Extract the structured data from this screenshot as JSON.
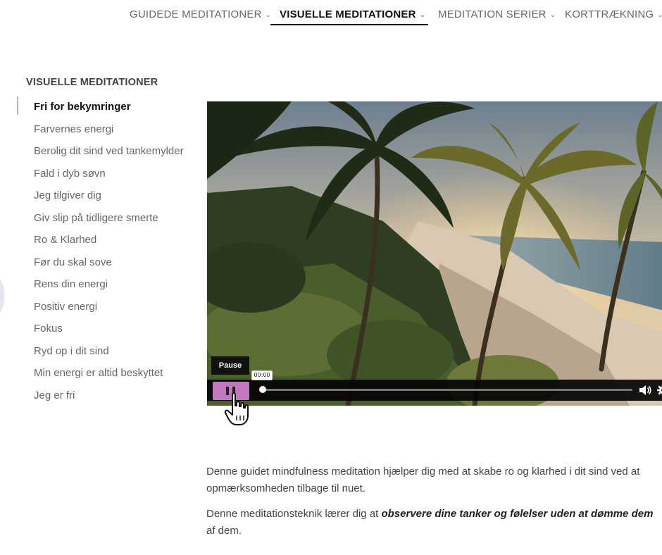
{
  "nav": {
    "items": [
      {
        "label": "GUIDEDE MEDITATIONER"
      },
      {
        "label": "VISUELLE MEDITATIONER"
      },
      {
        "label": "MEDITATION SERIER"
      },
      {
        "label": "KORTTRÆKNING"
      }
    ],
    "active_index": 1,
    "chevron": "chevron-down-icon"
  },
  "sidebar": {
    "heading": "VISUELLE MEDITATIONER",
    "items": [
      {
        "label": "Fri for bekymringer"
      },
      {
        "label": "Farvernes energi"
      },
      {
        "label": "Berolig dit sind ved tankemylder"
      },
      {
        "label": "Fald i dyb søvn"
      },
      {
        "label": "Jeg tilgiver dig"
      },
      {
        "label": "Giv slip på tidligere smerte"
      },
      {
        "label": "Ro & Klarhed"
      },
      {
        "label": "Før du skal sove"
      },
      {
        "label": "Rens din energi"
      },
      {
        "label": "Positiv energi"
      },
      {
        "label": "Fokus"
      },
      {
        "label": "Ryd op i dit sind"
      },
      {
        "label": "Min energi er altid beskyttet"
      },
      {
        "label": "Jeg er fri"
      }
    ],
    "active_index": 0
  },
  "video": {
    "tooltip": "Pause",
    "time": "00:00",
    "progress": 0,
    "accent_color": "#c177bd"
  },
  "description": {
    "p1_line1": "Denne guidet mindfulness meditation hjælper dig med at skabe ro og klarhed i dit sind ved at",
    "p1_line2": "opmærksomheden tilbage til nuet.",
    "p2_pre": "Denne meditationsteknik lærer dig at ",
    "p2_strong": "observere dine tanker og følelser uden at dømme dem",
    "p2_line2": "af dem."
  }
}
